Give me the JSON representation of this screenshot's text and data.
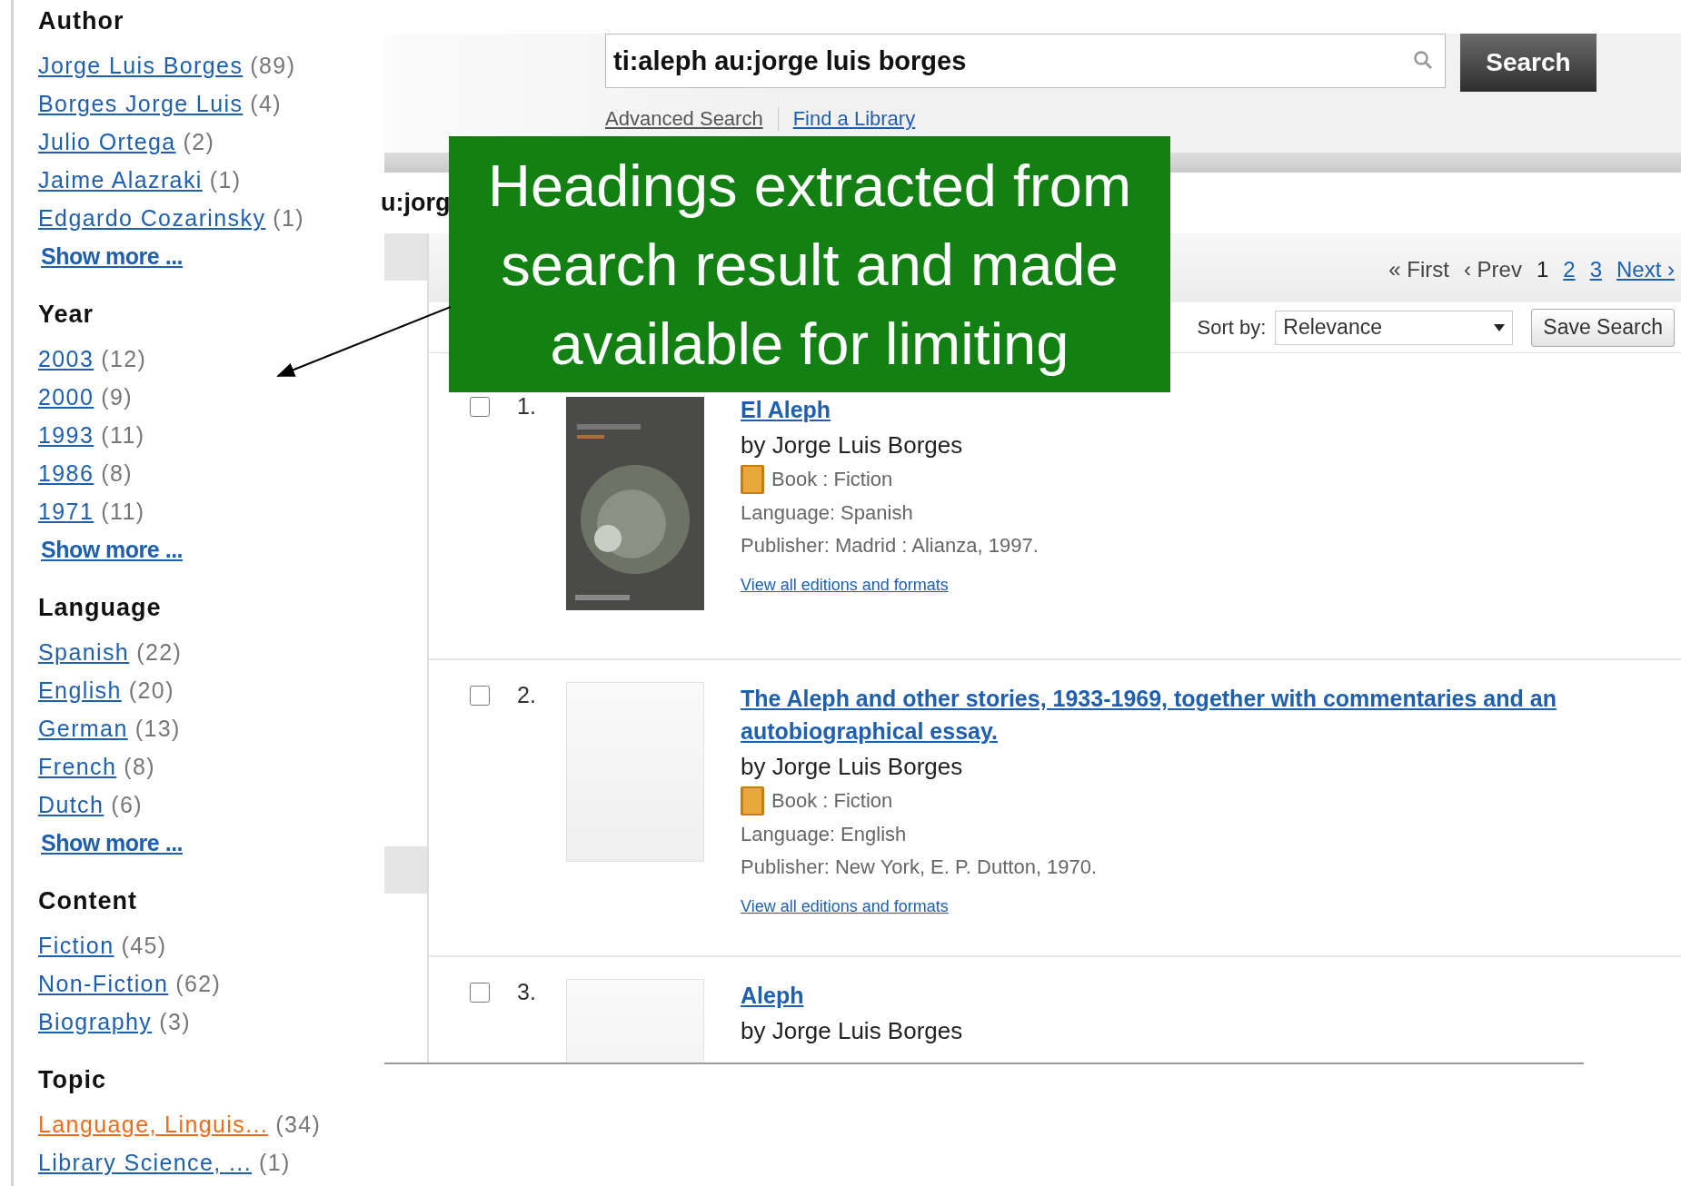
{
  "sidebar": {
    "facets": [
      {
        "heading": "Author",
        "items": [
          {
            "label": "Jorge Luis Borges",
            "count": "(89)",
            "selected": false
          },
          {
            "label": "Borges Jorge Luis",
            "count": "(4)",
            "selected": false
          },
          {
            "label": "Julio Ortega",
            "count": "(2)",
            "selected": false
          },
          {
            "label": "Jaime Alazraki",
            "count": "(1)",
            "selected": false
          },
          {
            "label": "Edgardo Cozarinsky",
            "count": "(1)",
            "selected": false
          }
        ],
        "show_more": "Show more ..."
      },
      {
        "heading": "Year",
        "items": [
          {
            "label": "2003",
            "count": "(12)",
            "selected": false
          },
          {
            "label": "2000",
            "count": "(9)",
            "selected": false
          },
          {
            "label": "1993",
            "count": "(11)",
            "selected": false
          },
          {
            "label": "1986",
            "count": "(8)",
            "selected": false
          },
          {
            "label": "1971",
            "count": "(11)",
            "selected": false
          }
        ],
        "show_more": "Show more ..."
      },
      {
        "heading": "Language",
        "items": [
          {
            "label": "Spanish",
            "count": "(22)",
            "selected": false
          },
          {
            "label": "English",
            "count": "(20)",
            "selected": false
          },
          {
            "label": "German",
            "count": "(13)",
            "selected": false
          },
          {
            "label": "French",
            "count": "(8)",
            "selected": false
          },
          {
            "label": "Dutch",
            "count": "(6)",
            "selected": false
          }
        ],
        "show_more": "Show more ..."
      },
      {
        "heading": "Content",
        "items": [
          {
            "label": "Fiction",
            "count": "(45)",
            "selected": false
          },
          {
            "label": "Non-Fiction",
            "count": "(62)",
            "selected": false
          },
          {
            "label": "Biography",
            "count": "(3)",
            "selected": false
          }
        ]
      },
      {
        "heading": "Topic",
        "items": [
          {
            "label": "Language, Linguis...",
            "count": "(34)",
            "selected": true
          },
          {
            "label": "Library Science, ...",
            "count": "(1)",
            "selected": false
          }
        ]
      }
    ]
  },
  "search": {
    "value": "ti:aleph au:jorge luis borges",
    "button": "Search",
    "links": [
      "Advanced Search",
      "Find a Library"
    ]
  },
  "query_heading": "u:jorg",
  "callout": {
    "text": "Headings extracted from search result and made available for limiting"
  },
  "pagination": {
    "nav_back": [
      {
        "label": "« First",
        "disabled": true
      },
      {
        "label": "‹ Prev",
        "disabled": true
      }
    ],
    "pages": [
      {
        "label": "1",
        "selected": true
      },
      {
        "label": "2",
        "selected": false
      },
      {
        "label": "3",
        "selected": false
      }
    ],
    "next": {
      "label": "Next ›",
      "disabled": false
    }
  },
  "sort": {
    "label": "Sort by:",
    "value": "Relevance"
  },
  "save_button": "Save Search",
  "results": [
    {
      "number": "1.",
      "checked": false,
      "kind": "picture",
      "title": "El Aleph",
      "author": "by Jorge Luis Borges",
      "format": "Book : Fiction",
      "language": "Language: Spanish",
      "publisher": "Publisher: Madrid : Alianza, 1997.",
      "editions_link": "View all editions and formats"
    },
    {
      "number": "2.",
      "checked": false,
      "kind": "blank",
      "title": "The Aleph and other stories, 1933-1969, together with commentaries and an autobiographical essay.",
      "author": "by Jorge Luis Borges",
      "format": "Book : Fiction",
      "language": "Language: English",
      "publisher": "Publisher: New York, E. P. Dutton, 1970.",
      "editions_link": "View all editions and formats"
    },
    {
      "number": "3.",
      "checked": false,
      "kind": "blank",
      "title": "Aleph",
      "author": "by Jorge Luis Borges"
    }
  ]
}
